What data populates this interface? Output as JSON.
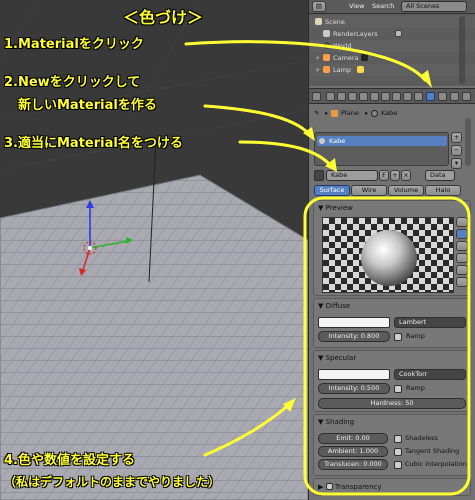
{
  "annotations": {
    "title": "＜色づけ＞",
    "step1": "1.Materialをクリック",
    "step2_line1": "2.Newをクリックして",
    "step2_line2": "新しいMaterialを作る",
    "step3": "3.適当にMaterial名をつける",
    "step4_line1": "4.色や数値を設定する",
    "step4_line2": "（私はデフォルトのままでやりました）"
  },
  "outliner_header": {
    "view": "View",
    "search": "Search",
    "scene_filter": "All Scenes"
  },
  "outliner": {
    "rows": [
      "Scene",
      "RenderLayers",
      "World",
      "Camera",
      "Lamp"
    ]
  },
  "breadcrumb": {
    "object": "Plane",
    "material": "Kabe"
  },
  "material_list": {
    "selected": "Kabe"
  },
  "material_id": {
    "name": "Kabe",
    "fake_user": "F",
    "link": "Data"
  },
  "tabs": [
    "Surface",
    "Wire",
    "Volume",
    "Halo"
  ],
  "preview": {
    "title": "Preview"
  },
  "diffuse": {
    "title": "Diffuse",
    "shader": "Lambert",
    "intensity": "Intensity: 0.800",
    "ramp": "Ramp"
  },
  "specular": {
    "title": "Specular",
    "shader": "CookTorr",
    "intensity": "Intensity: 0.500",
    "ramp": "Ramp",
    "hardness": "Hardness: 50"
  },
  "shading": {
    "title": "Shading",
    "emit": "Emit: 0.00",
    "ambient": "Ambient: 1.000",
    "translucency": "Translucen: 0.000",
    "shadeless": "Shadeless",
    "tangent": "Tangent Shading",
    "cubic": "Cubic Interpolation"
  },
  "transparency": {
    "title": "Transparency"
  },
  "colors": {
    "annotation": "#ffff33",
    "active_blue": "#5680c2",
    "viewport_bg": "#393939",
    "grid_plane": "#a8a8b0"
  }
}
